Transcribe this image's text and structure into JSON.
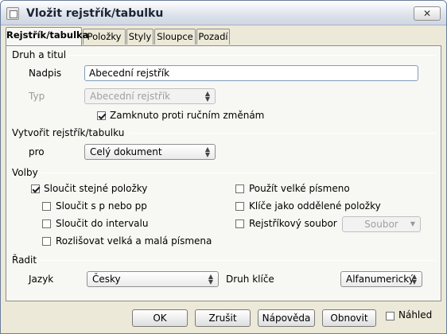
{
  "window": {
    "title": "Vložit rejstřík/tabulku",
    "close": "✕"
  },
  "tabs": [
    "Rejstřík/tabulka",
    "Položky",
    "Styly",
    "Sloupce",
    "Pozadí"
  ],
  "druh_a_titul": {
    "heading": "Druh a titul",
    "nadpis_label": "Nadpis",
    "nadpis_value": "Abecední rejstřík",
    "typ_label": "Typ",
    "typ_value": "Abecední rejstřík",
    "protect_label": "Zamknuto proti ručním změnám",
    "protect_checked": true
  },
  "vytvorit": {
    "heading": "Vytvořit rejstřík/tabulku",
    "pro_label": "pro",
    "pro_value": "Celý dokument"
  },
  "volby": {
    "heading": "Volby",
    "slucit_stejne": "Sloučit stejné položky",
    "slucit_sp": "Sloučit s p nebo pp",
    "slucit_interval": "Sloučit do intervalu",
    "rozlisovat": "Rozlišovat velká a malá písmena",
    "pouzit_velke": "Použít velké písmeno",
    "klice": "Klíče jako oddělené položky",
    "rejstrikovy": "Rejstříkový soubor",
    "soubor_button": "Soubor"
  },
  "radit": {
    "heading": "Řadit",
    "jazyk_label": "Jazyk",
    "jazyk_value": "Česky",
    "druh_klice_label": "Druh klíče",
    "druh_klice_value": "Alfanumerický"
  },
  "buttons": {
    "ok": "OK",
    "zrusit": "Zrušit",
    "napoveda": "Nápověda",
    "obnovit": "Obnovit"
  },
  "nahled_label": "Náhled"
}
